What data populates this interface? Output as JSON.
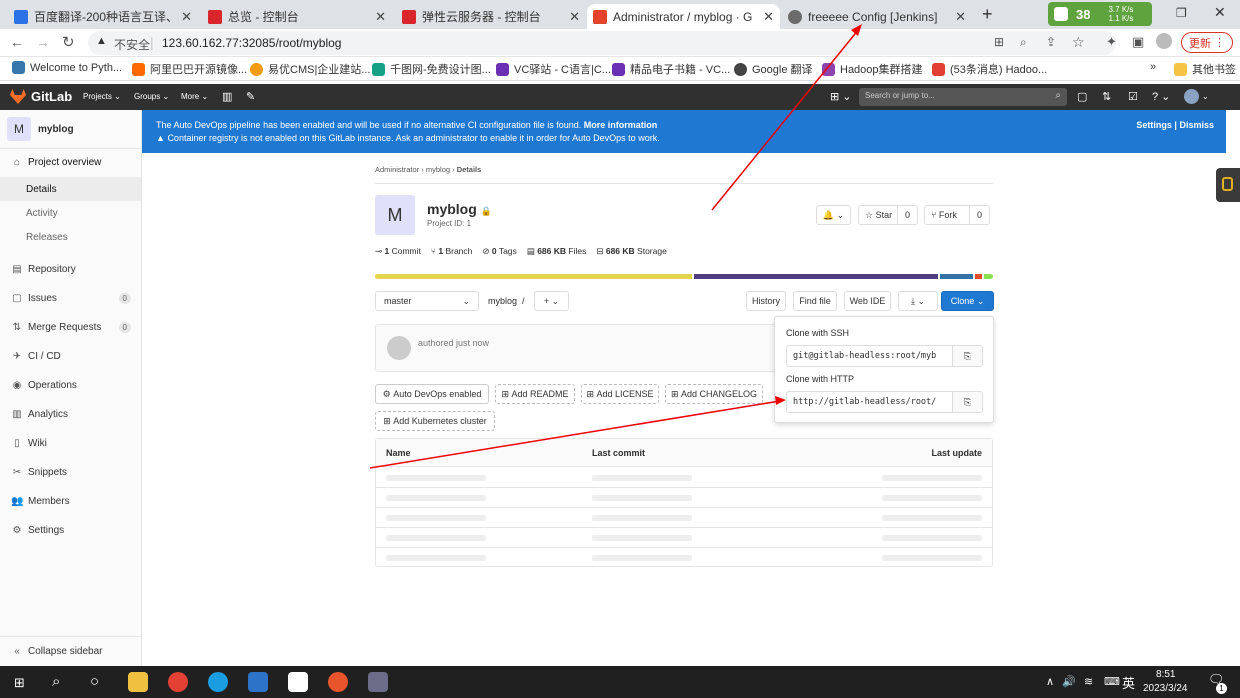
{
  "tabs": [
    {
      "title": "百度翻译-200种语言互译、沟通",
      "color": "#2a72e5"
    },
    {
      "title": "总览 - 控制台",
      "color": "#d8262c"
    },
    {
      "title": "弹性云服务器 - 控制台",
      "color": "#d8262c"
    },
    {
      "title": "Administrator / myblog · GitLa",
      "color": "#e2432a"
    },
    {
      "title": "freeeee Config [Jenkins]",
      "color": "#6b6b6b"
    }
  ],
  "tab_close": "✕",
  "new_tab": "+",
  "security_badge": "38",
  "net_speed_up": "3.7 K/s",
  "net_speed_down": "1.1 K/s",
  "address": {
    "insecure": "不安全",
    "url": "123.60.162.77:32085/root/myblog"
  },
  "update_button": "更新",
  "bookmarks": [
    "Welcome to Pyth...",
    "阿里巴巴开源镜像...",
    "易优CMS|企业建站...",
    "千图网-免费设计图...",
    "VC驿站 - C语言|C...",
    "精品电子书籍 - VC...",
    "Google 翻译",
    "Hadoop集群搭建",
    "(53条消息) Hadoo..."
  ],
  "bookmarks_more": "»",
  "bookmarks_other": "其他书签",
  "gitlab": {
    "brand": "GitLab",
    "nav": [
      "Projects",
      "Groups",
      "More"
    ],
    "search_placeholder": "Search or jump to..."
  },
  "sidebar": {
    "project_letter": "M",
    "project_name": "myblog",
    "items": [
      {
        "label": "Project overview",
        "icon": "⌂"
      },
      {
        "label": "Details"
      },
      {
        "label": "Activity"
      },
      {
        "label": "Releases"
      },
      {
        "label": "Repository",
        "icon": "▤"
      },
      {
        "label": "Issues",
        "icon": "▢",
        "count": "0"
      },
      {
        "label": "Merge Requests",
        "icon": "⇅",
        "count": "0"
      },
      {
        "label": "CI / CD",
        "icon": "✈"
      },
      {
        "label": "Operations",
        "icon": "◉"
      },
      {
        "label": "Analytics",
        "icon": "▥"
      },
      {
        "label": "Wiki",
        "icon": "▯"
      },
      {
        "label": "Snippets",
        "icon": "✂"
      },
      {
        "label": "Members",
        "icon": "👥"
      },
      {
        "label": "Settings",
        "icon": "⚙"
      }
    ],
    "collapse": "Collapse sidebar"
  },
  "banner": {
    "line1": "The Auto DevOps pipeline has been enabled and will be used if no alternative CI configuration file is found.",
    "line1_link": "More information",
    "line2": "Container registry is not enabled on this GitLab instance. Ask an administrator to enable it in order for Auto DevOps to work.",
    "settings": "Settings",
    "sep": "|",
    "dismiss": "Dismiss"
  },
  "breadcrumb": [
    "Administrator",
    "myblog",
    "Details"
  ],
  "project": {
    "letter": "M",
    "name": "myblog",
    "id": "Project ID: 1"
  },
  "stats": [
    {
      "value": "1",
      "label": "Commit"
    },
    {
      "value": "1",
      "label": "Branch"
    },
    {
      "value": "0",
      "label": "Tags"
    },
    {
      "value": "686 KB",
      "label": "Files"
    },
    {
      "value": "686 KB",
      "label": "Storage"
    }
  ],
  "actions": {
    "star": "Star",
    "star_count": "0",
    "fork": "Fork",
    "fork_count": "0"
  },
  "lang_bar": [
    {
      "fraction": 0.52,
      "color": "#e4d54c"
    },
    {
      "fraction": 0.4,
      "color": "#4f3d7f"
    },
    {
      "fraction": 0.054,
      "color": "#3572a5"
    },
    {
      "fraction": 0.012,
      "color": "#e34c26"
    },
    {
      "fraction": 0.014,
      "color": "#89e051"
    }
  ],
  "toolbar": {
    "branch": "master",
    "path": "myblog",
    "plus": "+",
    "history": "History",
    "find_file": "Find file",
    "web_ide": "Web IDE",
    "clone": "Clone"
  },
  "commit": {
    "text": "authored just now"
  },
  "clone": {
    "ssh_title": "Clone with SSH",
    "ssh_url": "git@gitlab-headless:root/myb",
    "http_title": "Clone with HTTP",
    "http_url": "http://gitlab-headless/root/"
  },
  "quick_actions": [
    "Auto DevOps enabled",
    "Add README",
    "Add LICENSE",
    "Add CHANGELOG",
    "Add Kubernetes cluster"
  ],
  "table": {
    "headers": [
      "Name",
      "Last commit",
      "Last update"
    ],
    "rows": 5
  },
  "taskbar": {
    "lang": "英",
    "time": "8:51",
    "date": "2023/3/24",
    "notif": "1"
  }
}
